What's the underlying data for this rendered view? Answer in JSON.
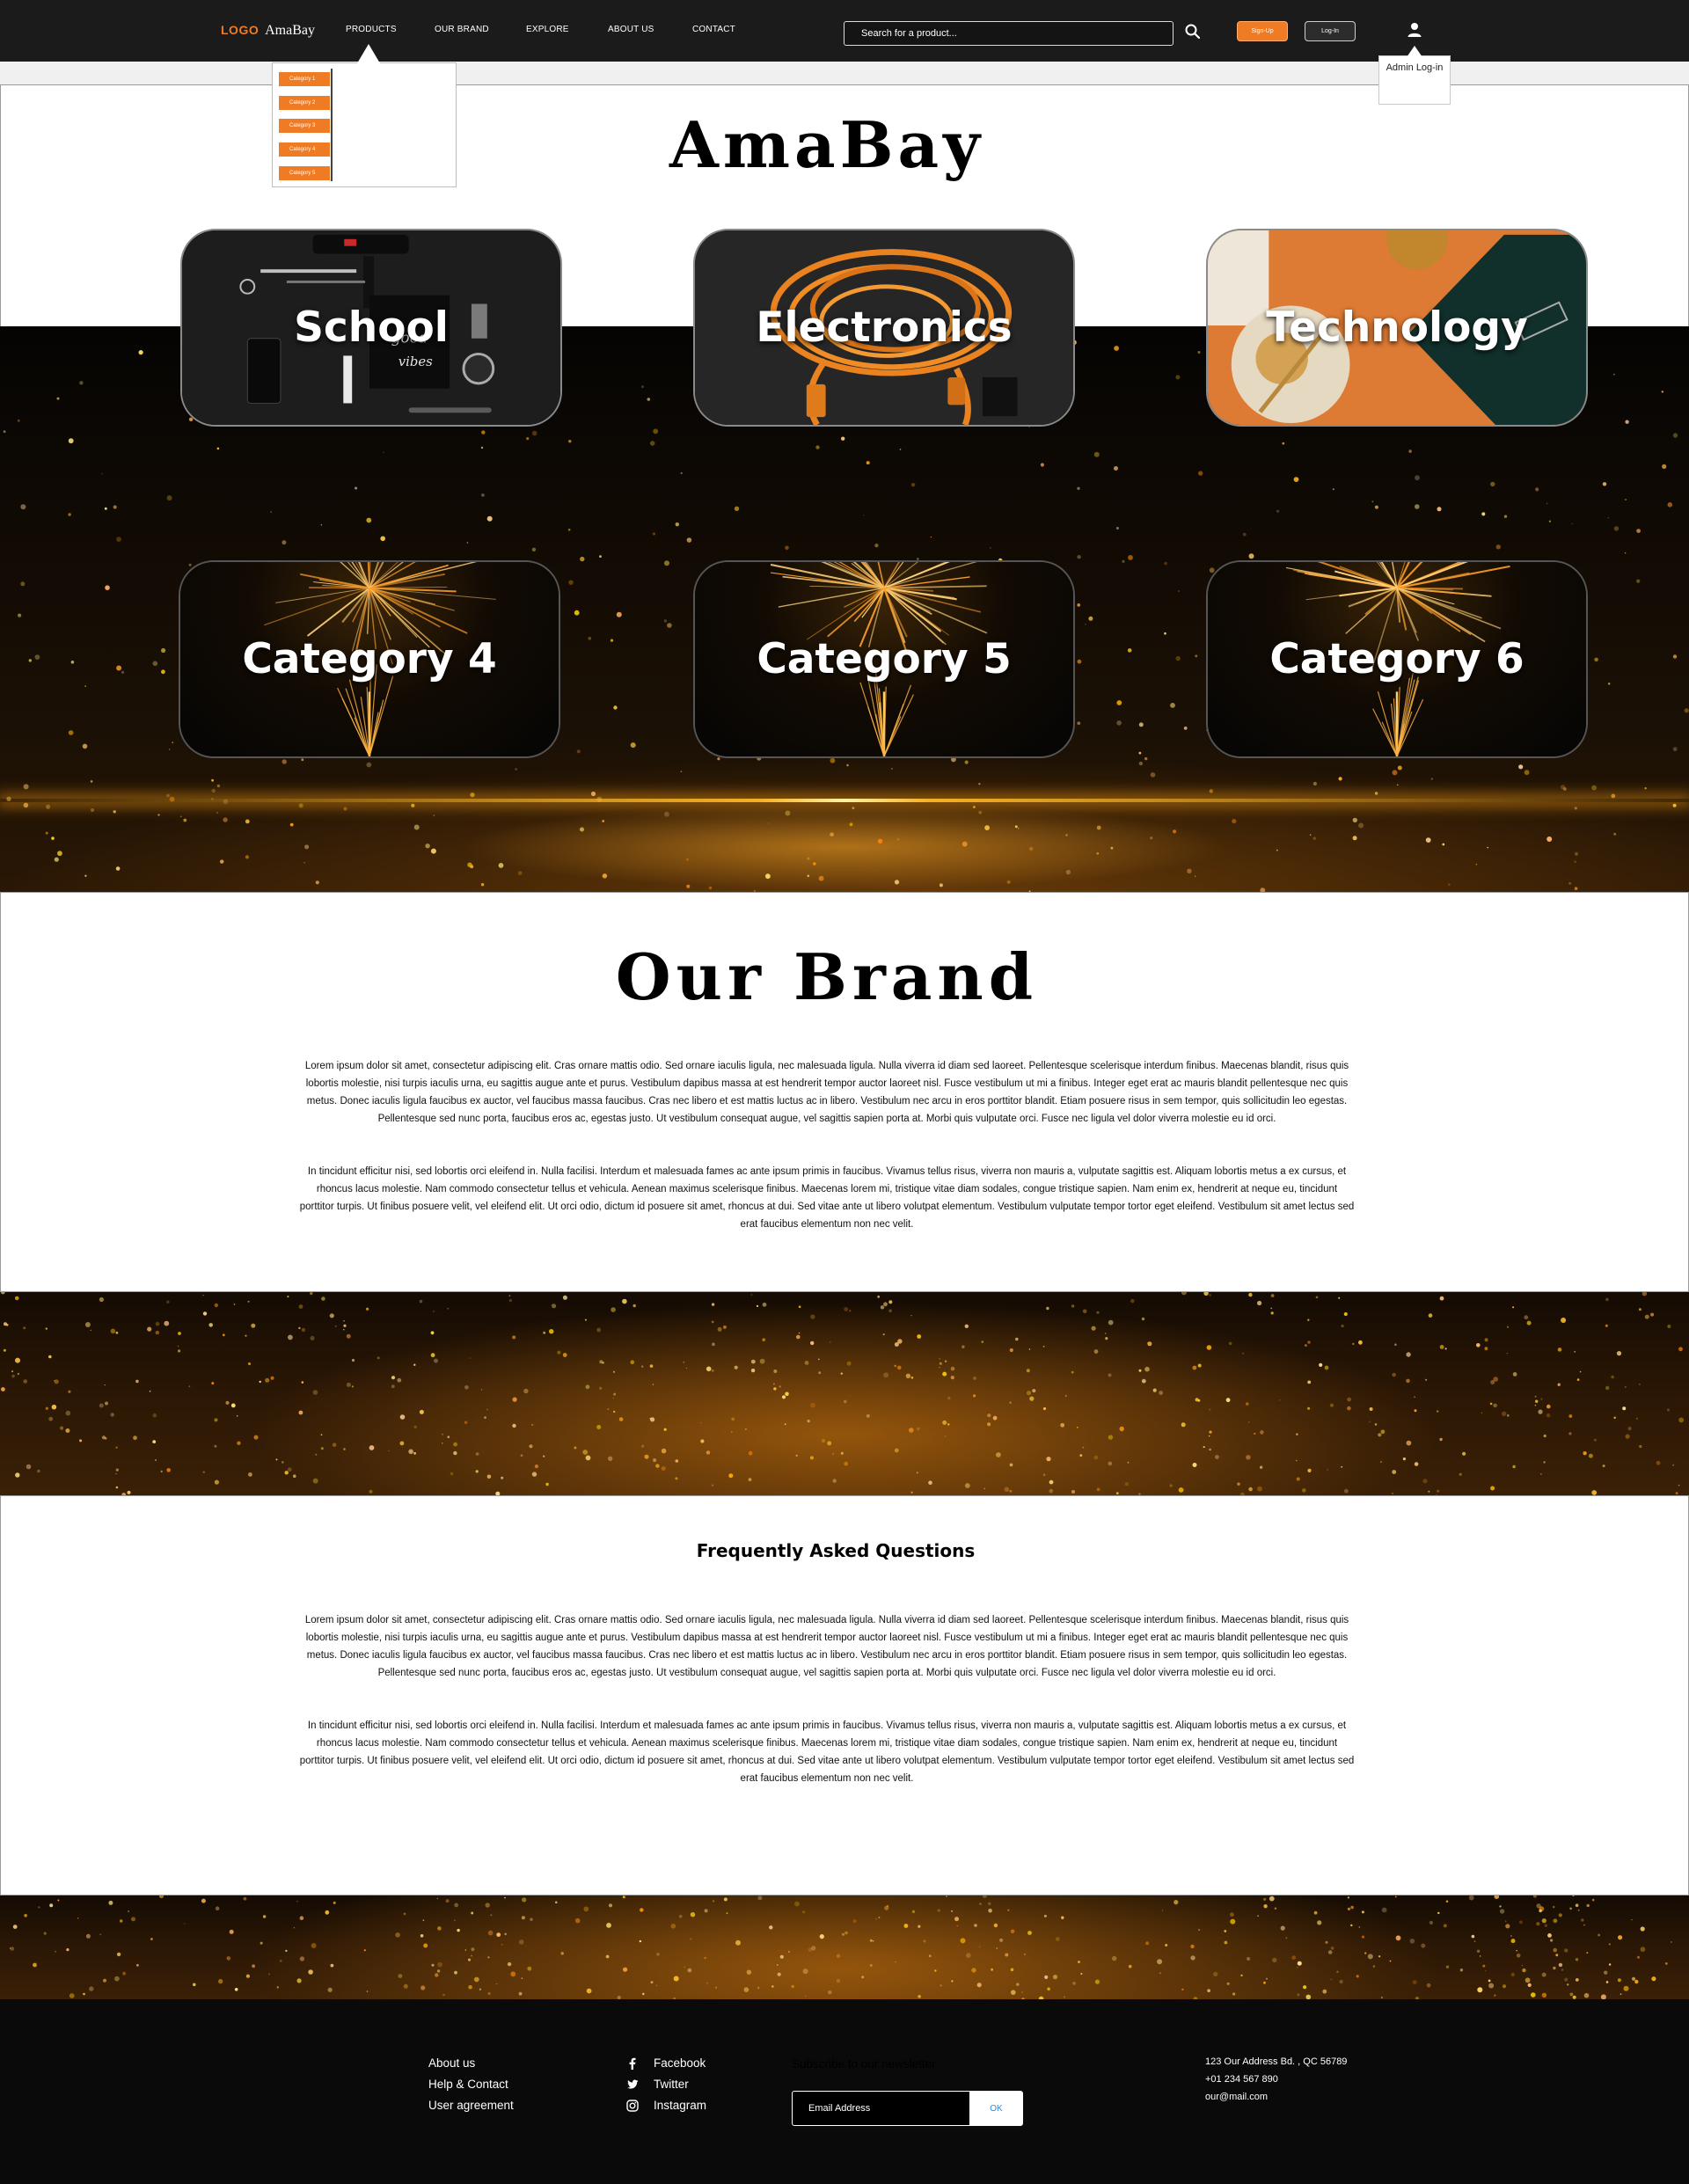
{
  "nav": {
    "logo_mark": "LOGO",
    "logo_name": "AmaBay",
    "items": [
      "PRODUCTS",
      "OUR BRAND",
      "EXPLORE",
      "ABOUT US",
      "CONTACT"
    ],
    "search_placeholder": "Search for a product...",
    "signup_label": "Sign-Up",
    "login_label": "Log-In",
    "admin_login_label": "Admin Log-in"
  },
  "products_dropdown": [
    "Category 1",
    "Category 2",
    "Category 3",
    "Category 4",
    "Category 5"
  ],
  "hero": {
    "title": "AmaBay",
    "categories": [
      "School",
      "Electronics",
      "Technology",
      "Category 4",
      "Category 5",
      "Category 6"
    ]
  },
  "brand": {
    "title": "Our Brand",
    "paragraph_1": "Lorem ipsum dolor sit amet, consectetur adipiscing elit. Cras ornare mattis odio. Sed ornare iaculis ligula, nec malesuada ligula. Nulla viverra id diam sed laoreet. Pellentesque scelerisque interdum finibus. Maecenas blandit, risus quis lobortis molestie, nisi turpis iaculis urna, eu sagittis augue ante et purus. Vestibulum dapibus massa at est hendrerit tempor auctor laoreet nisl. Fusce vestibulum ut mi a finibus. Integer eget erat ac mauris blandit pellentesque nec quis metus. Donec iaculis ligula faucibus ex auctor, vel faucibus massa faucibus. Cras nec libero et est mattis luctus ac in libero. Vestibulum nec arcu in eros porttitor blandit. Etiam posuere risus in sem tempor, quis sollicitudin leo egestas. Pellentesque sed nunc porta, faucibus eros ac, egestas justo. Ut vestibulum consequat augue, vel sagittis sapien porta at. Morbi quis vulputate orci. Fusce nec ligula vel dolor viverra molestie eu id orci.",
    "paragraph_2": "In tincidunt efficitur nisi, sed lobortis orci eleifend in. Nulla facilisi. Interdum et malesuada fames ac ante ipsum primis in faucibus. Vivamus tellus risus, viverra non mauris a, vulputate sagittis est. Aliquam lobortis metus a ex cursus, et rhoncus lacus molestie. Nam commodo consectetur tellus et vehicula. Aenean maximus scelerisque finibus. Maecenas lorem mi, tristique vitae diam sodales, congue tristique sapien. Nam enim ex, hendrerit at neque eu, tincidunt porttitor turpis. Ut finibus posuere velit, vel eleifend elit. Ut orci odio, dictum id posuere sit amet, rhoncus at dui. Sed vitae ante ut libero volutpat elementum. Vestibulum vulputate tempor tortor eget eleifend. Vestibulum sit amet lectus sed erat faucibus elementum non nec velit."
  },
  "faq": {
    "title": "Frequently Asked Questions",
    "paragraph_1": "Lorem ipsum dolor sit amet, consectetur adipiscing elit. Cras ornare mattis odio. Sed ornare iaculis ligula, nec malesuada ligula. Nulla viverra id diam sed laoreet. Pellentesque scelerisque interdum finibus. Maecenas blandit, risus quis lobortis molestie, nisi turpis iaculis urna, eu sagittis augue ante et purus. Vestibulum dapibus massa at est hendrerit tempor auctor laoreet nisl. Fusce vestibulum ut mi a finibus. Integer eget erat ac mauris blandit pellentesque nec quis metus. Donec iaculis ligula faucibus ex auctor, vel faucibus massa faucibus. Cras nec libero et est mattis luctus ac in libero. Vestibulum nec arcu in eros porttitor blandit. Etiam posuere risus in sem tempor, quis sollicitudin leo egestas. Pellentesque sed nunc porta, faucibus eros ac, egestas justo. Ut vestibulum consequat augue, vel sagittis sapien porta at. Morbi quis vulputate orci. Fusce nec ligula vel dolor viverra molestie eu id orci.",
    "paragraph_2": "In tincidunt efficitur nisi, sed lobortis orci eleifend in. Nulla facilisi. Interdum et malesuada fames ac ante ipsum primis in faucibus. Vivamus tellus risus, viverra non mauris a, vulputate sagittis est. Aliquam lobortis metus a ex cursus, et rhoncus lacus molestie. Nam commodo consectetur tellus et vehicula. Aenean maximus scelerisque finibus. Maecenas lorem mi, tristique vitae diam sodales, congue tristique sapien. Nam enim ex, hendrerit at neque eu, tincidunt porttitor turpis. Ut finibus posuere velit, vel eleifend elit. Ut orci odio, dictum id posuere sit amet, rhoncus at dui. Sed vitae ante ut libero volutpat elementum. Vestibulum vulputate tempor tortor eget eleifend. Vestibulum sit amet lectus sed erat faucibus elementum non nec velit."
  },
  "footer": {
    "links": [
      "About us",
      "Help & Contact",
      "User agreement"
    ],
    "social": [
      "Facebook",
      "Twitter",
      "Instagram"
    ],
    "newsletter_title": "Subscribe to our newsletter",
    "email_placeholder": "Email Address",
    "ok_label": "OK",
    "address": "123 Our Address Bd. , QC 56789",
    "phone": "+01 234 567 890",
    "email": "our@mail.com"
  },
  "colors": {
    "accent": "#ef7b25",
    "navbar": "#1b1b1b",
    "footer": "#0a0a0a",
    "ok_text": "#2a8be8"
  },
  "icons": [
    "search-icon",
    "user-icon",
    "facebook-icon",
    "twitter-icon",
    "instagram-icon"
  ]
}
